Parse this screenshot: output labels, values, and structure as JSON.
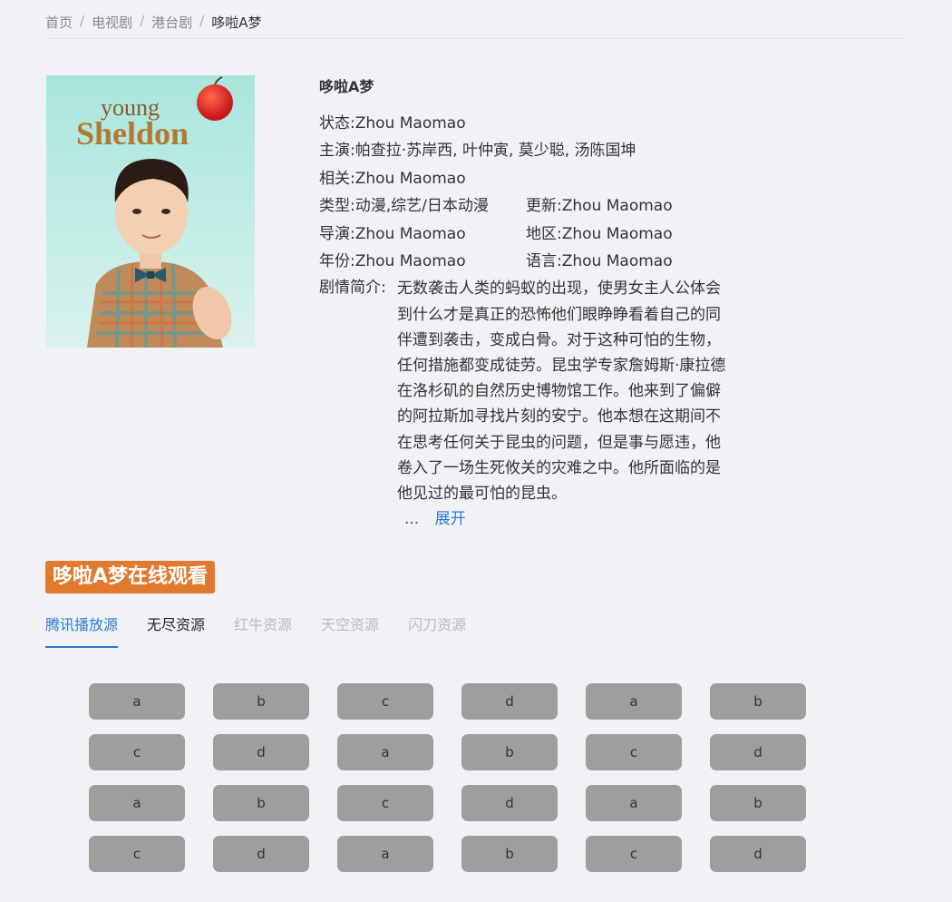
{
  "breadcrumb": {
    "home": "首页",
    "category": "电视剧",
    "sub": "港台剧",
    "current": "哆啦A梦",
    "separator": "/"
  },
  "poster": {
    "line1": "young",
    "line2": "Sheldon"
  },
  "info": {
    "title": "哆啦A梦",
    "status_label": "状态:",
    "status_value": "Zhou Maomao",
    "cast_label": "主演:",
    "cast_value": "帕查拉·苏岸西, 叶仲寅, 莫少聪, 汤陈国坤",
    "related_label": "相关:",
    "related_value": "Zhou Maomao",
    "type_label": "类型:",
    "type_value": "动漫,综艺/日本动漫",
    "update_label": "更新:",
    "update_value": "Zhou Maomao",
    "director_label": "导演:",
    "director_value": "Zhou Maomao",
    "region_label": "地区:",
    "region_value": "Zhou Maomao",
    "year_label": "年份:",
    "year_value": "Zhou Maomao",
    "language_label": "语言:",
    "language_value": "Zhou Maomao",
    "synopsis_label": "剧情简介:",
    "synopsis_text": "无数袭击人类的蚂蚁的出现，使男女主人公体会到什么才是真正的恐怖他们眼睁睁看着自己的同伴遭到袭击，变成白骨。对于这种可怕的生物，任何措施都变成徒劳。昆虫学专家詹姆斯·康拉德在洛杉矶的自然历史博物馆工作。他来到了偏僻的阿拉斯加寻找片刻的安宁。他本想在这期间不在思考任何关于昆虫的问题，但是事与愿违，他卷入了一场生死攸关的灾难之中。他所面临的是他见过的最可怕的昆虫。",
    "ellipsis": "...",
    "expand": "展开"
  },
  "watch": {
    "title": "哆啦A梦在线观看"
  },
  "tabs": [
    "腾讯播放源",
    "无尽资源",
    "红牛资源",
    "天空资源",
    "闪刀资源"
  ],
  "episodes": [
    "a",
    "b",
    "c",
    "d",
    "a",
    "b",
    "c",
    "d",
    "a",
    "b",
    "c",
    "d",
    "a",
    "b",
    "c",
    "d",
    "a",
    "b",
    "c",
    "d",
    "a",
    "b",
    "c",
    "d"
  ],
  "colors": {
    "accent": "#2b7bd3",
    "watch_title_bg": "#e07a2e",
    "episode_bg": "#a09e9c",
    "page_bg": "#f1f2f6"
  }
}
